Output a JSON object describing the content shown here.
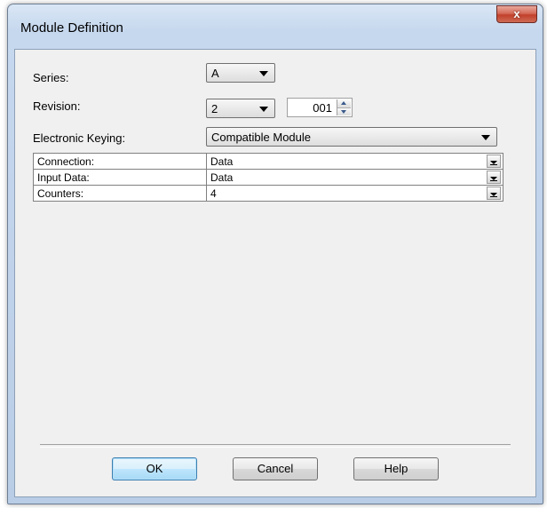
{
  "window": {
    "title": "Module Definition",
    "close_glyph": "x"
  },
  "form": {
    "series": {
      "label": "Series:",
      "value": "A"
    },
    "revision": {
      "label": "Revision:",
      "major": "2",
      "minor": "001"
    },
    "keying": {
      "label": "Electronic Keying:",
      "value": "Compatible Module"
    }
  },
  "grid": {
    "rows": [
      {
        "name": "Connection:",
        "value": "Data"
      },
      {
        "name": "Input Data:",
        "value": "Data"
      },
      {
        "name": "Counters:",
        "value": "4"
      }
    ]
  },
  "buttons": {
    "ok": "OK",
    "cancel": "Cancel",
    "help": "Help"
  },
  "icons": {
    "close": "close-icon",
    "dropdown": "chevron-down-icon",
    "spin_up": "spin-up-icon",
    "spin_down": "spin-down-icon"
  }
}
